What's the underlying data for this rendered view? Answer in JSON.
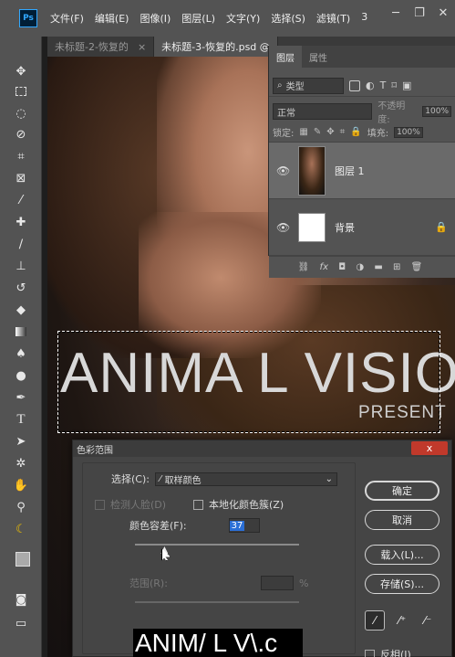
{
  "menubar": {
    "logo": "Ps",
    "items": [
      "文件(F)",
      "编辑(E)",
      "图像(I)",
      "图层(L)",
      "文字(Y)",
      "选择(S)",
      "滤镜(T)",
      "3"
    ],
    "window_controls": [
      "minimize-icon",
      "restore-icon",
      "close-icon"
    ]
  },
  "tabs": [
    {
      "label": "未标题-2-恢复的",
      "close": "×"
    },
    {
      "label": "未标题-3-恢复的.psd @",
      "close": ""
    }
  ],
  "toolbar": {
    "tools": [
      "move-icon",
      "marquee-icon",
      "lasso-icon",
      "quick-select-icon",
      "crop-icon",
      "frame-icon",
      "eyedropper-icon",
      "healing-icon",
      "brush-icon",
      "stamp-icon",
      "history-brush-icon",
      "eraser-icon",
      "gradient-icon",
      "blur-icon",
      "dodge-icon",
      "pen-icon",
      "type-icon",
      "path-select-icon",
      "shape-icon",
      "hand-icon",
      "zoom-icon",
      "banana-icon"
    ],
    "type_glyph": "T"
  },
  "canvas": {
    "title_text": "ANIMA L VISIO",
    "subtitle_text": "PRESENT"
  },
  "layers_panel": {
    "tabs": [
      "图层",
      "属性"
    ],
    "filter_kind": "类型",
    "blend_mode": "正常",
    "opacity_label": "不透明度:",
    "opacity_value": "100%",
    "lock_label": "锁定:",
    "fill_label": "填充:",
    "fill_value": "100%",
    "layers": [
      {
        "name": "图层 1",
        "visible": true,
        "selected": true
      },
      {
        "name": "背景",
        "visible": true,
        "locked": true
      }
    ],
    "bottom_icons": [
      "link-icon",
      "fx-icon",
      "mask-icon",
      "adjustment-icon",
      "group-icon",
      "new-layer-icon",
      "delete-icon"
    ],
    "fx_label": "fx"
  },
  "color_range_dialog": {
    "title": "色彩范围",
    "close_label": "x",
    "select_label": "选择(C):",
    "select_value": "取样颜色",
    "detect_faces_label": "检测人脸(D)",
    "localized_label": "本地化颜色簇(Z)",
    "fuzziness_label": "颜色容差(F):",
    "fuzziness_value": "37",
    "fuzziness_level": 0.18,
    "range_label": "范围(R):",
    "range_unit": "%",
    "preview_text": "ANIM/ L V\\.c",
    "buttons": {
      "ok": "确定",
      "cancel": "取消",
      "load": "载入(L)...",
      "save": "存储(S)..."
    },
    "invert_label": "反相(I)",
    "droppers": [
      "eyedropper-icon",
      "eyedropper-plus-icon",
      "eyedropper-minus-icon"
    ]
  }
}
